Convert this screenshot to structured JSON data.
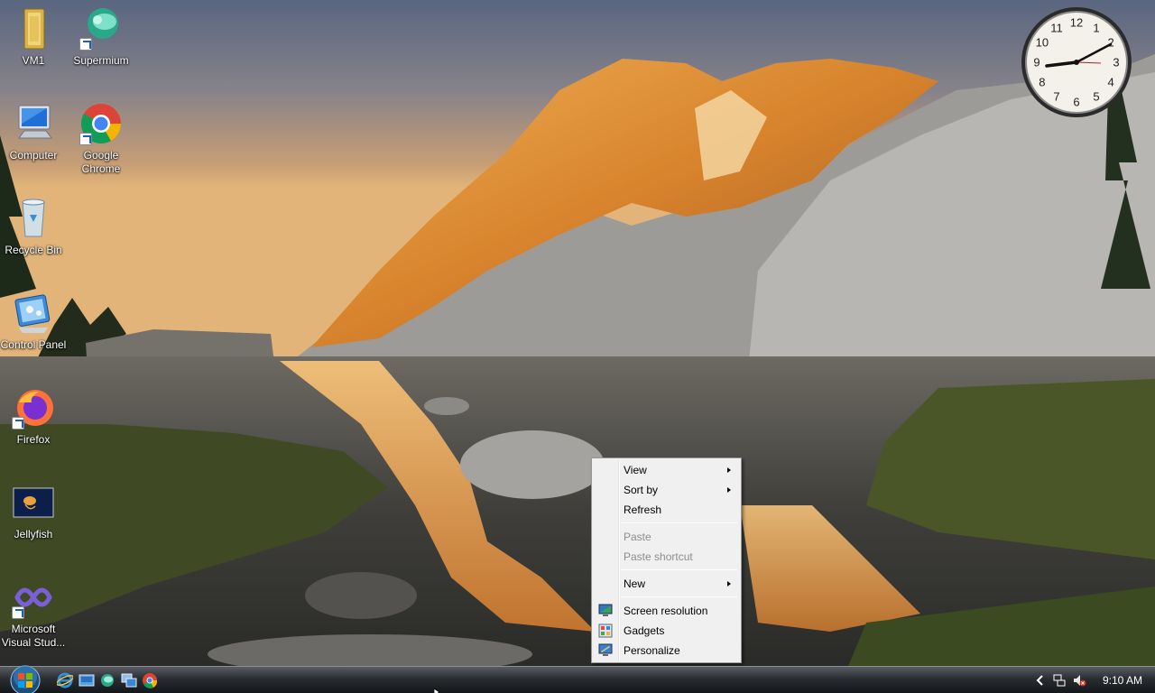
{
  "desktop_icons": [
    {
      "label": "VM1"
    },
    {
      "label": "Supermium"
    },
    {
      "label": "Computer"
    },
    {
      "label": "Google Chrome"
    },
    {
      "label": "Recycle Bin"
    },
    {
      "label": "Control Panel"
    },
    {
      "label": "Firefox"
    },
    {
      "label": "Jellyfish"
    },
    {
      "label": "Microsoft Visual Stud..."
    }
  ],
  "clock": {
    "numerals": [
      "12",
      "1",
      "2",
      "3",
      "4",
      "5",
      "6",
      "7",
      "8",
      "9",
      "10",
      "11"
    ],
    "time": "9:10"
  },
  "context_menu": {
    "items": [
      {
        "label": "View",
        "submenu": true,
        "enabled": true
      },
      {
        "label": "Sort by",
        "submenu": true,
        "enabled": true
      },
      {
        "label": "Refresh",
        "submenu": false,
        "enabled": true
      },
      {
        "label": "Paste",
        "submenu": false,
        "enabled": false
      },
      {
        "label": "Paste shortcut",
        "submenu": false,
        "enabled": false
      },
      {
        "label": "New",
        "submenu": true,
        "enabled": true
      },
      {
        "label": "Screen resolution",
        "icon": "monitor-icon",
        "enabled": true
      },
      {
        "label": "Gadgets",
        "icon": "gadgets-icon",
        "enabled": true
      },
      {
        "label": "Personalize",
        "icon": "personalize-icon",
        "enabled": true
      }
    ]
  },
  "taskbar": {
    "quick_launch": [
      "internet-explorer-icon",
      "show-desktop-icon",
      "supermium-icon",
      "switch-windows-icon",
      "chrome-icon"
    ],
    "tray_icons": [
      "network-icon",
      "volume-muted-icon"
    ],
    "time": "9:10 AM"
  },
  "colors": {
    "menu_bg": "#f0f0f0",
    "menu_disabled_text": "#8d8d8d",
    "taskbar_top": "#595d63",
    "taskbar_bottom": "#14171a"
  }
}
